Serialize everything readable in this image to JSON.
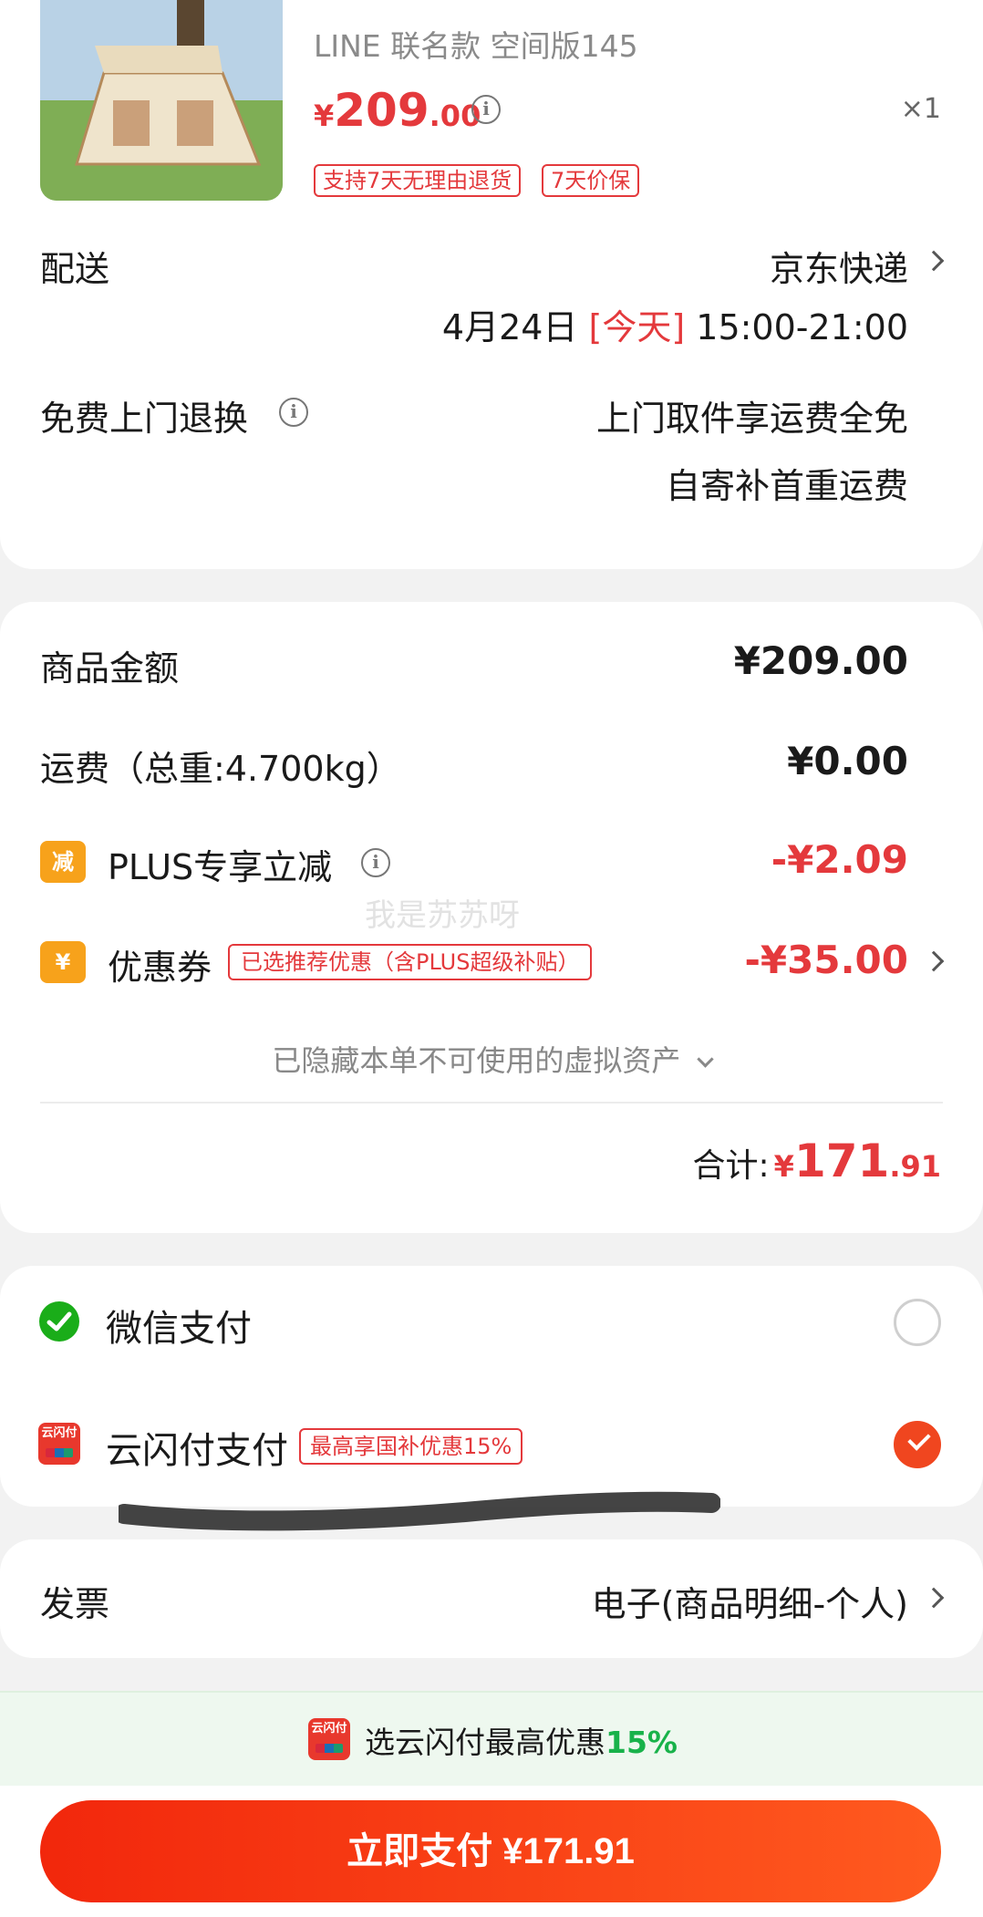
{
  "product": {
    "subtitle": "LINE 联名款 空间版145",
    "price_currency": "¥",
    "price_int": "209",
    "price_dec": ".00",
    "quantity": "×1",
    "tags": [
      "支持7天无理由退货",
      "7天价保"
    ]
  },
  "delivery": {
    "label": "配送",
    "carrier": "京东快递",
    "date": "4月24日 ",
    "today": "[今天]",
    "time": " 15:00-21:00"
  },
  "returns": {
    "label": "免费上门退换",
    "line1": "上门取件享运费全免",
    "line2": "自寄补首重运费"
  },
  "amounts": {
    "goods_label": "商品金额",
    "goods_value": "¥209.00",
    "shipping_label": "运费（总重:4.700kg）",
    "shipping_value": "¥0.00",
    "plus_badge": "减",
    "plus_label": "PLUS专享立减",
    "plus_value": "-¥2.09",
    "coupon_badge": "¥",
    "coupon_label": "优惠券",
    "coupon_tag": "已选推荐优惠（含PLUS超级补贴）",
    "coupon_value": "-¥35.00",
    "hidden_assets": "已隐藏本单不可使用的虚拟资产",
    "total_label": "合计:",
    "total_currency": "¥",
    "total_int": "171",
    "total_dec": ".91",
    "watermark": "我是苏苏呀"
  },
  "payment": {
    "wechat_label": "微信支付",
    "unionpay_label": "云闪付支付",
    "unionpay_icon_text": "云闪付",
    "unionpay_promo": "最高享国补优惠15%",
    "selected": "unionpay"
  },
  "invoice": {
    "label": "发票",
    "value": "电子(商品明细-个人)"
  },
  "promo_strip": {
    "text": "选云闪付最高优惠",
    "percent": "15%"
  },
  "pay_button": {
    "label": "立即支付 ¥171.91"
  },
  "colors": {
    "accent_red": "#e4393c",
    "button_start": "#f2270c",
    "button_end": "#ff5a1f",
    "wechat_green": "#1aad19",
    "promo_green": "#18b24a"
  }
}
